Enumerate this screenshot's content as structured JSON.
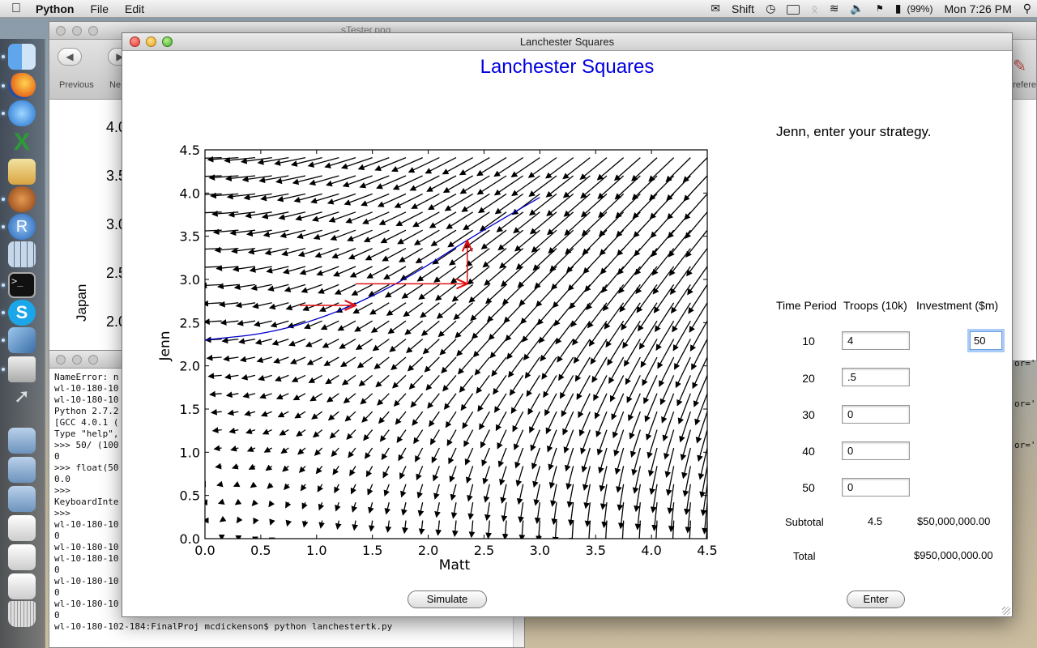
{
  "menubar": {
    "app_name": "Python",
    "menus": [
      "File",
      "Edit"
    ],
    "shift_label": "Shift",
    "battery": "(99%)",
    "clock": "Mon 7:26 PM"
  },
  "preview": {
    "title_fragment": "...sTester.png",
    "previous_label": "Previous",
    "next_label": "Ne",
    "preferences_fragment": "refere",
    "ylabel": "Japan",
    "yticks": [
      "4.0",
      "3.5",
      "3.0",
      "2.5",
      "2.0"
    ]
  },
  "terminal": {
    "lines": [
      "NameError: n",
      "wl-10-180-10",
      "wl-10-180-10",
      "Python 2.7.2",
      "[GCC 4.0.1 (",
      "Type \"help\",",
      ">>> 50/ (100",
      "0",
      ">>> float(50",
      "0.0",
      ">>>",
      "KeyboardInte",
      ">>>",
      "wl-10-180-10",
      "0",
      "wl-10-180-10",
      "wl-10-180-10",
      "0",
      "wl-10-180-10",
      "0",
      "wl-10-180-10",
      "0",
      "wl-10-180-102-184:FinalProj mcdickenson$ python lanchestertk.py"
    ],
    "right_fragments": [
      "or='r",
      "or='r",
      "or='r"
    ]
  },
  "app": {
    "window_title": "Lanchester Squares",
    "heading": "Lanchester Squares",
    "prompt": "Jenn, enter your strategy.",
    "headers": {
      "time_period": "Time Period",
      "troops": "Troops (10k)",
      "investment": "Investment ($m)"
    },
    "rows": [
      {
        "period": "10",
        "troops": "4",
        "investment": "50"
      },
      {
        "period": "20",
        "troops": ".5"
      },
      {
        "period": "30",
        "troops": "0"
      },
      {
        "period": "40",
        "troops": "0"
      },
      {
        "period": "50",
        "troops": "0"
      }
    ],
    "subtotal_label": "Subtotal",
    "subtotal_troops": "4.5",
    "subtotal_investment": "$50,000,000.00",
    "total_label": "Total",
    "total_investment": "$950,000,000.00",
    "simulate_label": "Simulate",
    "enter_label": "Enter"
  },
  "chart_data": {
    "type": "quiver",
    "title": "",
    "xlabel": "Matt",
    "ylabel": "Jenn",
    "xlim": [
      0.0,
      4.5
    ],
    "ylim": [
      0.0,
      4.5
    ],
    "xticks": [
      "0.0",
      "0.5",
      "1.0",
      "1.5",
      "2.0",
      "2.5",
      "3.0",
      "3.5",
      "4.0",
      "4.5"
    ],
    "yticks": [
      "0.0",
      "0.5",
      "1.0",
      "1.5",
      "2.0",
      "2.5",
      "3.0",
      "3.5",
      "4.0",
      "4.5"
    ],
    "vector_field": "dx = -y, dy = -x",
    "grid_step": 0.15,
    "trajectory": {
      "color": "#0000cc",
      "x": [
        0.0,
        0.6,
        1.2,
        1.8,
        2.4,
        3.0
      ],
      "y": [
        2.3,
        2.38,
        2.62,
        3.0,
        3.5,
        3.95
      ]
    },
    "red_arrows": [
      {
        "from": [
          0.85,
          2.7
        ],
        "to": [
          1.35,
          2.7
        ]
      },
      {
        "from": [
          1.35,
          2.95
        ],
        "to": [
          2.35,
          2.95
        ]
      },
      {
        "from": [
          2.35,
          2.95
        ],
        "to": [
          2.35,
          3.45
        ]
      }
    ],
    "colors": {
      "field": "#000000",
      "trajectory": "#0000cc",
      "arrows": "#e01010"
    }
  }
}
